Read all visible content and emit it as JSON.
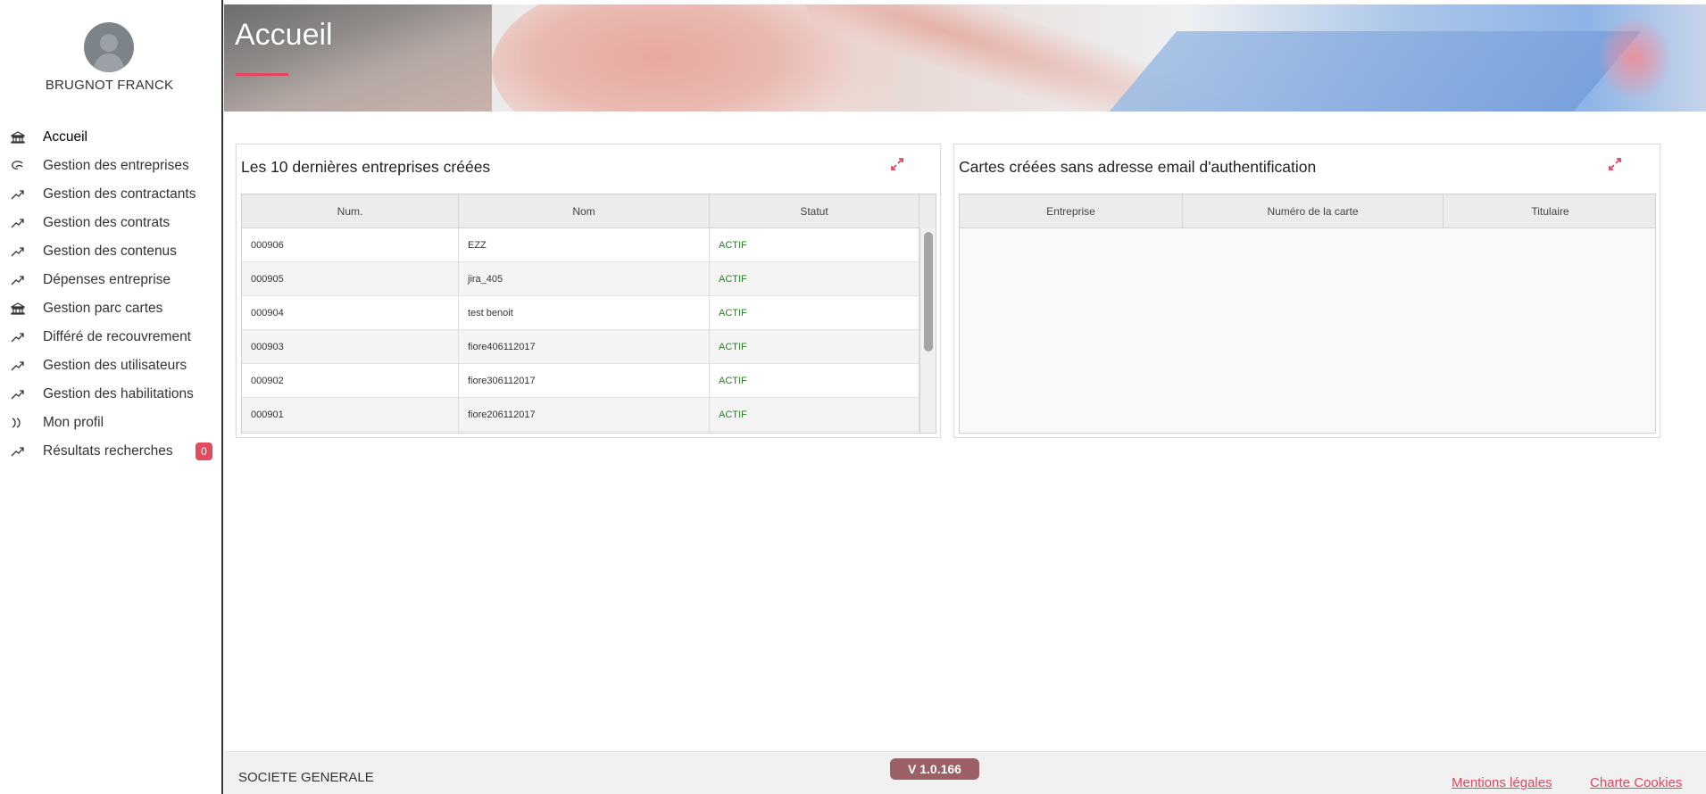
{
  "user": {
    "name": "BRUGNOT FRANCK"
  },
  "sidebar": {
    "items": [
      {
        "label": "Accueil",
        "icon": "bank-icon",
        "active": true
      },
      {
        "label": "Gestion des entreprises",
        "icon": "swirl-icon"
      },
      {
        "label": "Gestion des contractants",
        "icon": "trend-icon"
      },
      {
        "label": "Gestion des contrats",
        "icon": "trend-icon"
      },
      {
        "label": "Gestion des contenus",
        "icon": "trend-icon"
      },
      {
        "label": "Dépenses entreprise",
        "icon": "trend-icon"
      },
      {
        "label": "Gestion parc cartes",
        "icon": "bank-icon"
      },
      {
        "label": "Différé de recouvrement",
        "icon": "trend-icon"
      },
      {
        "label": "Gestion des utilisateurs",
        "icon": "trend-icon"
      },
      {
        "label": "Gestion des habilitations",
        "icon": "trend-icon"
      },
      {
        "label": "Mon profil",
        "icon": "double-chevron-icon"
      },
      {
        "label": "Résultats recherches",
        "icon": "trend-icon",
        "badge": "0"
      }
    ]
  },
  "header": {
    "title": "Accueil"
  },
  "panels": {
    "recent_companies": {
      "title": "Les 10 dernières entreprises créées",
      "columns": [
        "Num.",
        "Nom",
        "Statut"
      ],
      "rows": [
        [
          "000906",
          "EZZ",
          "ACTIF"
        ],
        [
          "000905",
          "jira_405",
          "ACTIF"
        ],
        [
          "000904",
          "test benoit",
          "ACTIF"
        ],
        [
          "000903",
          "fiore406112017",
          "ACTIF"
        ],
        [
          "000902",
          "fiore306112017",
          "ACTIF"
        ],
        [
          "000901",
          "fiore206112017",
          "ACTIF"
        ]
      ]
    },
    "cards_no_email": {
      "title": "Cartes créées sans adresse email d'authentification",
      "columns": [
        "Entreprise",
        "Numéro de la carte",
        "Titulaire"
      ],
      "rows": []
    }
  },
  "footer": {
    "company": "SOCIETE GENERALE",
    "version": "V 1.0.166",
    "legal": "Mentions légales",
    "cookies": "Charte Cookies"
  },
  "colors": {
    "accent": "#e2455d",
    "status_active": "#1a8a1a",
    "version_badge": "#9a6066"
  }
}
